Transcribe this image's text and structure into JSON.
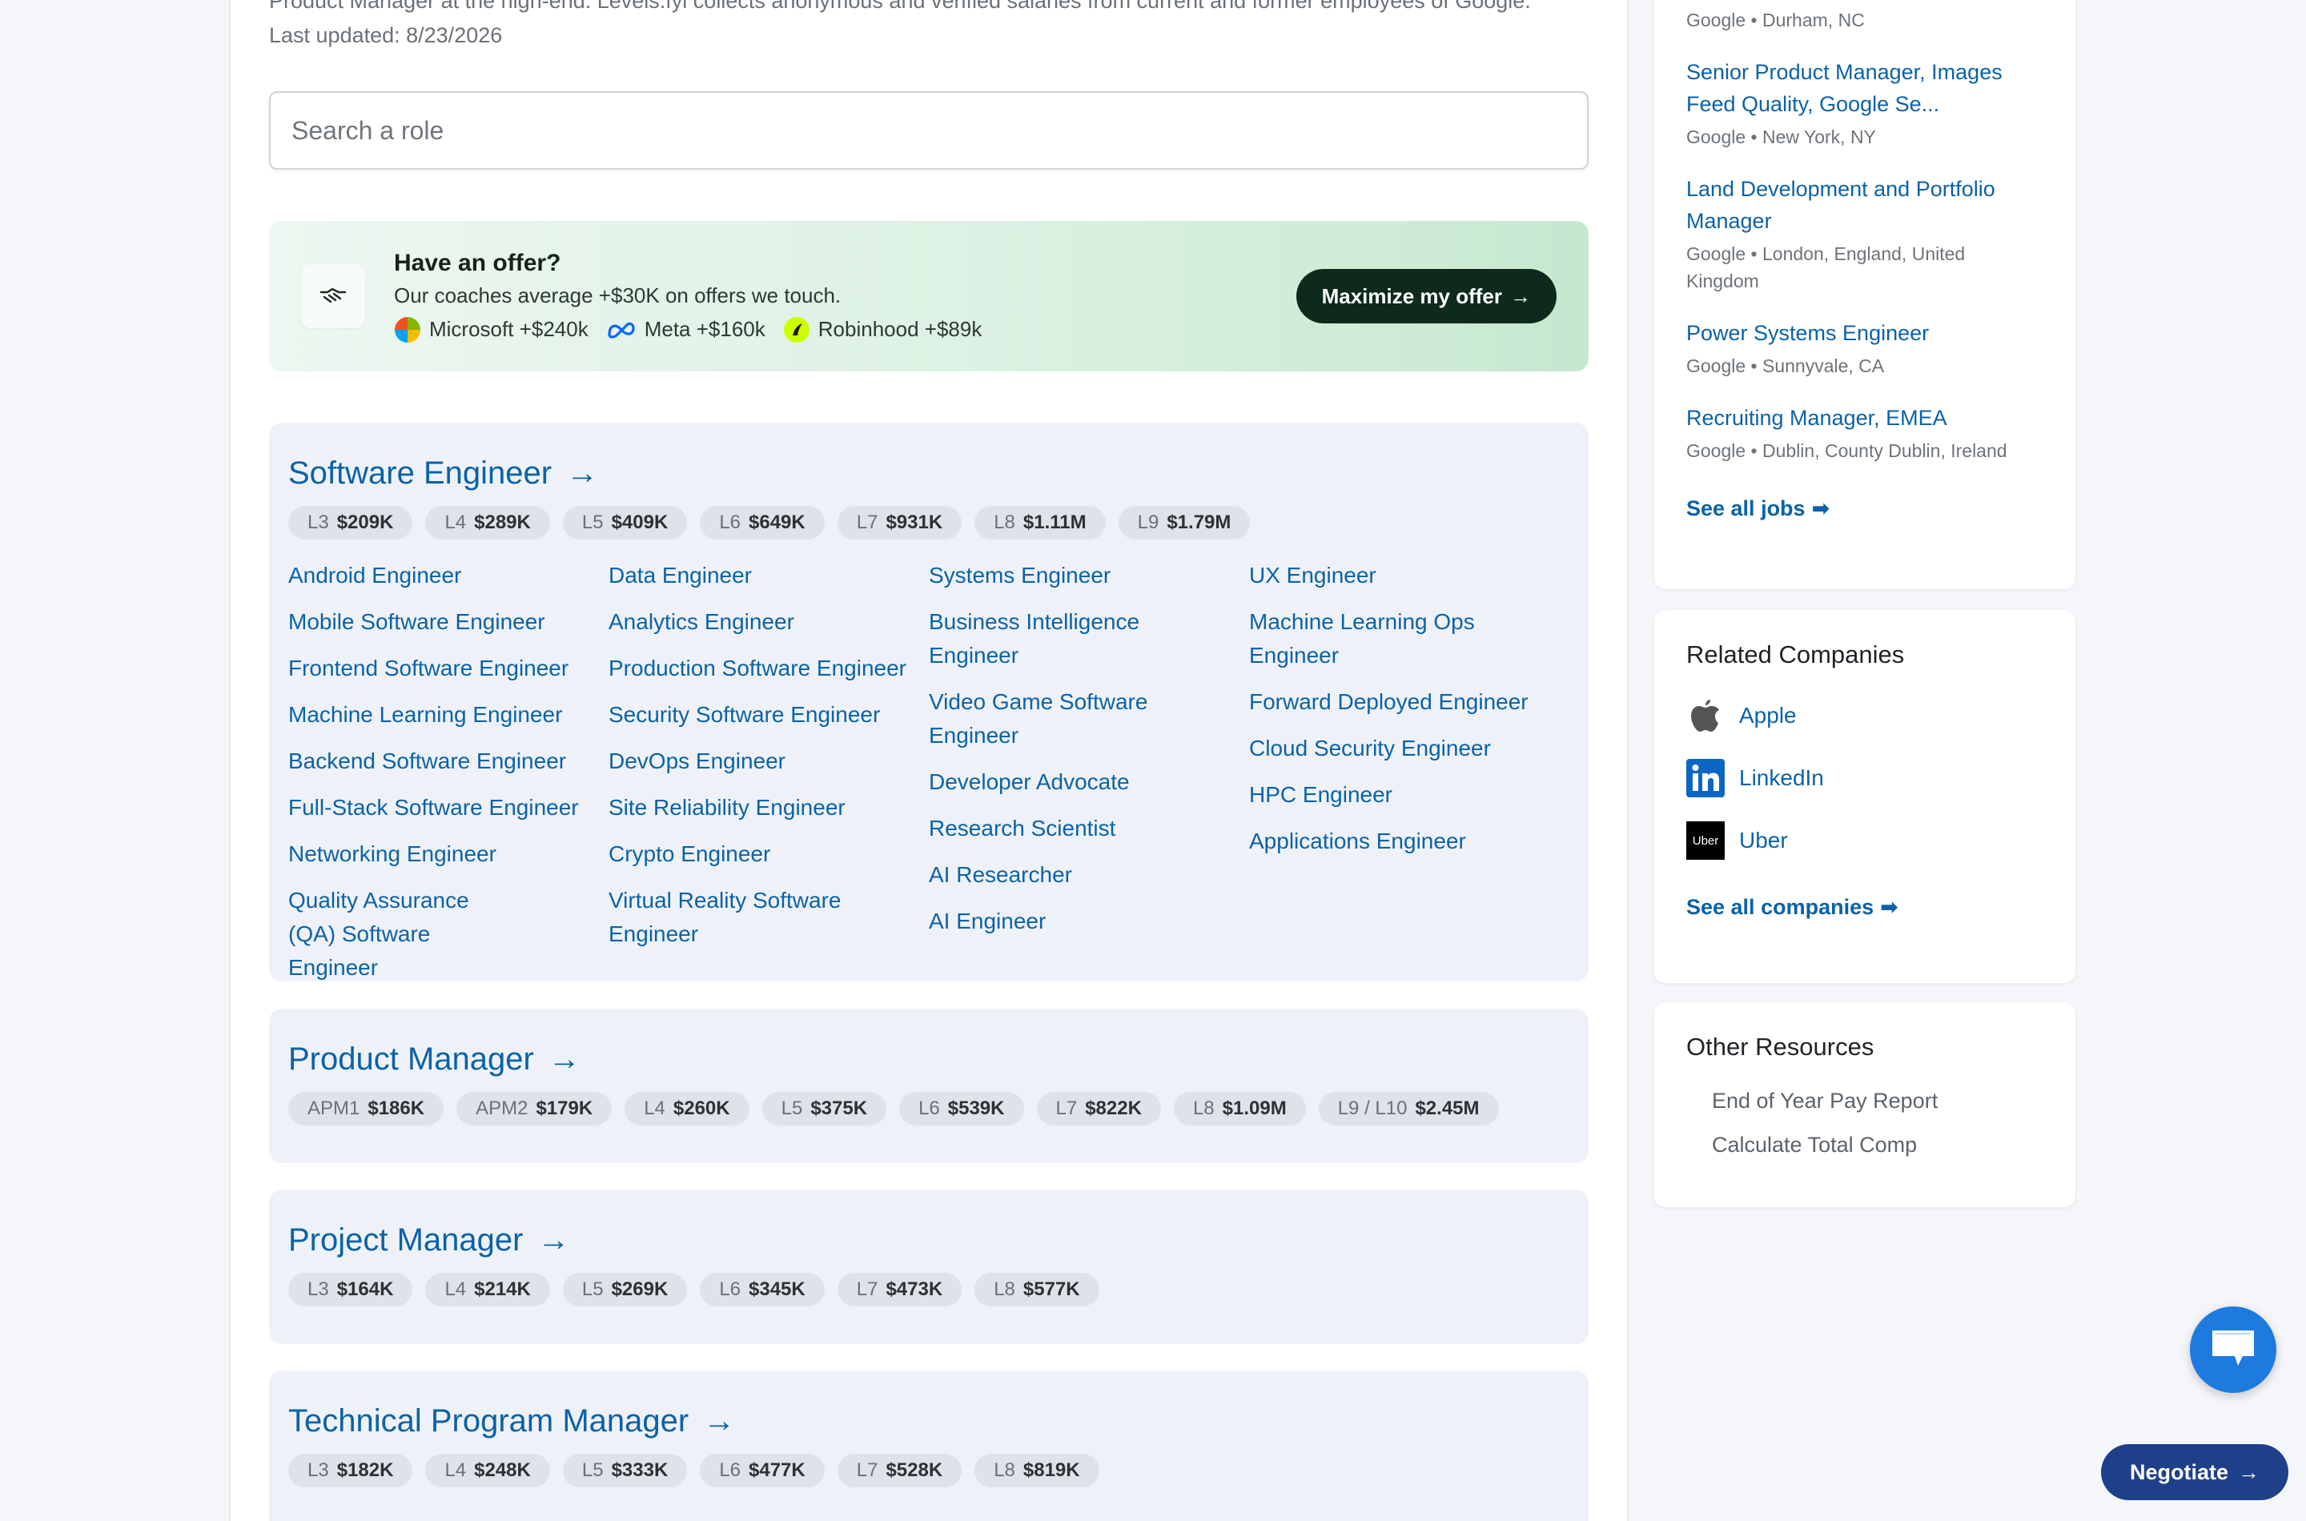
{
  "intro": {
    "line1": "Product Manager at the high-end. Levels.fyi collects anonymous and verified salaries from current and former employees of Google.",
    "line2": "Last updated: 8/23/2026"
  },
  "search": {
    "placeholder": "Search a role"
  },
  "offer": {
    "title": "Have an offer?",
    "subtitle": "Our coaches average +$30K on offers we touch.",
    "companies": [
      {
        "label": "Microsoft +$240k",
        "icon": "microsoft-logo"
      },
      {
        "label": "Meta +$160k",
        "icon": "meta-logo"
      },
      {
        "label": "Robinhood +$89k",
        "icon": "robinhood-logo"
      }
    ],
    "button": "Maximize my offer",
    "colors": {
      "bg_start": "#edf7f1",
      "bg_end": "#c6e8cf",
      "button": "#0d2a1c"
    }
  },
  "roles": [
    {
      "title": "Software Engineer",
      "chips": [
        {
          "level": "L3",
          "value": "$209K"
        },
        {
          "level": "L4",
          "value": "$289K"
        },
        {
          "level": "L5",
          "value": "$409K"
        },
        {
          "level": "L6",
          "value": "$649K"
        },
        {
          "level": "L7",
          "value": "$931K"
        },
        {
          "level": "L8",
          "value": "$1.11M"
        },
        {
          "level": "L9",
          "value": "$1.79M"
        }
      ],
      "subroles": [
        [
          "Android Engineer",
          "Mobile Software Engineer",
          "Frontend Software Engineer",
          "Machine Learning Engineer",
          "Backend Software Engineer",
          "Full-Stack Software Engineer",
          "Networking Engineer",
          "Quality Assurance (QA) Software Engineer"
        ],
        [
          "Data Engineer",
          "Analytics Engineer",
          "Production Software Engineer",
          "Security Software Engineer",
          "DevOps Engineer",
          "Site Reliability Engineer",
          "Crypto Engineer",
          "Virtual Reality Software Engineer"
        ],
        [
          "Systems Engineer",
          "Business Intelligence Engineer",
          "Video Game Software Engineer",
          "Developer Advocate",
          "Research Scientist",
          "AI Researcher",
          "AI Engineer"
        ],
        [
          "UX Engineer",
          "Machine Learning Ops Engineer",
          "Forward Deployed Engineer",
          "Cloud Security Engineer",
          "HPC Engineer",
          "Applications Engineer"
        ]
      ]
    },
    {
      "title": "Product Manager",
      "chips": [
        {
          "level": "APM1",
          "value": "$186K"
        },
        {
          "level": "APM2",
          "value": "$179K"
        },
        {
          "level": "L4",
          "value": "$260K"
        },
        {
          "level": "L5",
          "value": "$375K"
        },
        {
          "level": "L6",
          "value": "$539K"
        },
        {
          "level": "L7",
          "value": "$822K"
        },
        {
          "level": "L8",
          "value": "$1.09M"
        },
        {
          "level": "L9 / L10",
          "value": "$2.45M"
        }
      ]
    },
    {
      "title": "Project Manager",
      "chips": [
        {
          "level": "L3",
          "value": "$164K"
        },
        {
          "level": "L4",
          "value": "$214K"
        },
        {
          "level": "L5",
          "value": "$269K"
        },
        {
          "level": "L6",
          "value": "$345K"
        },
        {
          "level": "L7",
          "value": "$473K"
        },
        {
          "level": "L8",
          "value": "$577K"
        }
      ]
    },
    {
      "title": "Technical Program Manager",
      "chips": [
        {
          "level": "L3",
          "value": "$182K"
        },
        {
          "level": "L4",
          "value": "$248K"
        },
        {
          "level": "L5",
          "value": "$333K"
        },
        {
          "level": "L6",
          "value": "$477K"
        },
        {
          "level": "L7",
          "value": "$528K"
        },
        {
          "level": "L8",
          "value": "$819K"
        }
      ]
    }
  ],
  "jobs": {
    "top_meta": "Google • Durham, NC",
    "items": [
      {
        "title": "Senior Product Manager, Images Feed Quality, Google Se...",
        "meta": "Google • New York, NY"
      },
      {
        "title": "Land Development and Portfolio Manager",
        "meta": "Google • London, England, United Kingdom"
      },
      {
        "title": "Power Systems Engineer",
        "meta": "Google • Sunnyvale, CA"
      },
      {
        "title": "Recruiting Manager, EMEA",
        "meta": "Google • Dublin, County Dublin, Ireland"
      }
    ],
    "see_all": "See all jobs"
  },
  "related": {
    "title": "Related Companies",
    "companies": [
      {
        "name": "Apple",
        "icon": "apple-logo"
      },
      {
        "name": "LinkedIn",
        "icon": "linkedin-logo"
      },
      {
        "name": "Uber",
        "icon": "uber-logo",
        "logo_text": "Uber"
      }
    ],
    "see_all": "See all companies"
  },
  "resources": {
    "title": "Other Resources",
    "items": [
      "End of Year Pay Report",
      "Calculate Total Comp"
    ]
  },
  "negotiate": {
    "label": "Negotiate"
  },
  "colors": {
    "link": "#0b62a8",
    "role_card_bg": "#eef2f8",
    "chat_fab": "#1f7ae0",
    "negotiate_bg": "#1e3f8a"
  }
}
